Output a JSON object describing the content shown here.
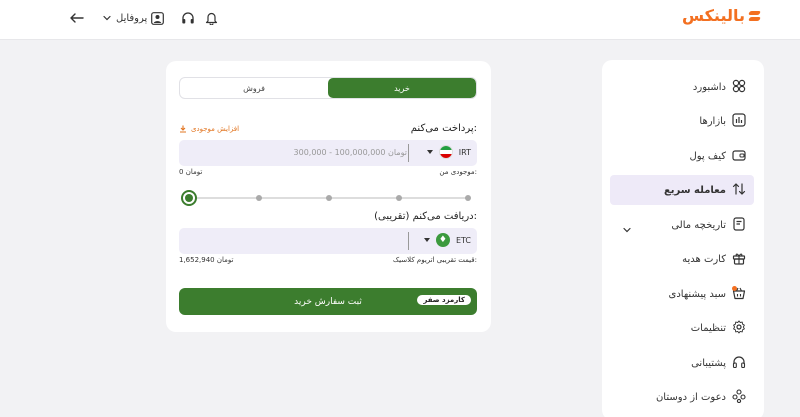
{
  "header": {
    "logo_text": "بالینکس",
    "profile_label": "پروفایل",
    "icons": [
      "back-arrow-icon",
      "chevron-down-icon",
      "profile-icon",
      "headset-icon",
      "bell-icon"
    ]
  },
  "sidebar": {
    "items": [
      {
        "label": "داشبورد",
        "icon": "dashboard-icon"
      },
      {
        "label": "بازارها",
        "icon": "markets-icon"
      },
      {
        "label": "کیف پول",
        "icon": "wallet-icon"
      },
      {
        "label": "معامله سریع",
        "icon": "swap-arrows-icon",
        "active": true
      },
      {
        "label": "تاریخچه مالی",
        "icon": "history-icon"
      },
      {
        "label": "کارت هدیه",
        "icon": "gift-icon"
      },
      {
        "label": "سبد پیشنهادی",
        "icon": "basket-icon"
      },
      {
        "label": "تنظیمات",
        "icon": "gear-icon"
      },
      {
        "label": "پشتیبانی",
        "icon": "headset-icon"
      },
      {
        "label": "دعوت از دوستان",
        "icon": "invite-icon"
      }
    ]
  },
  "trade": {
    "tabs": [
      "فروش",
      "خرید"
    ],
    "active_tab": "خرید",
    "pay_label": "پرداخت می‌کنم:",
    "increase_balance": "افزایش موجودی",
    "pay_currency": "IRT",
    "pay_placeholder": "300,000 - 100,000,000 تومان",
    "balance_label": "موجودی من:",
    "balance_value": "0 تومان",
    "slider_value": 0,
    "receive_label": "دریافت می‌کنم (تقریبی):",
    "receive_currency": "ETC",
    "price_label": "قیمت تقریبی اتریوم کلاسیک:",
    "price_value": "1,652,940 تومان",
    "submit_label": "ثبت سفارش خرید",
    "fee_badge": "کارمزد صفر",
    "colors": {
      "primary": "#3c7d2e",
      "accent": "#f37021",
      "field": "#efedf8"
    }
  }
}
